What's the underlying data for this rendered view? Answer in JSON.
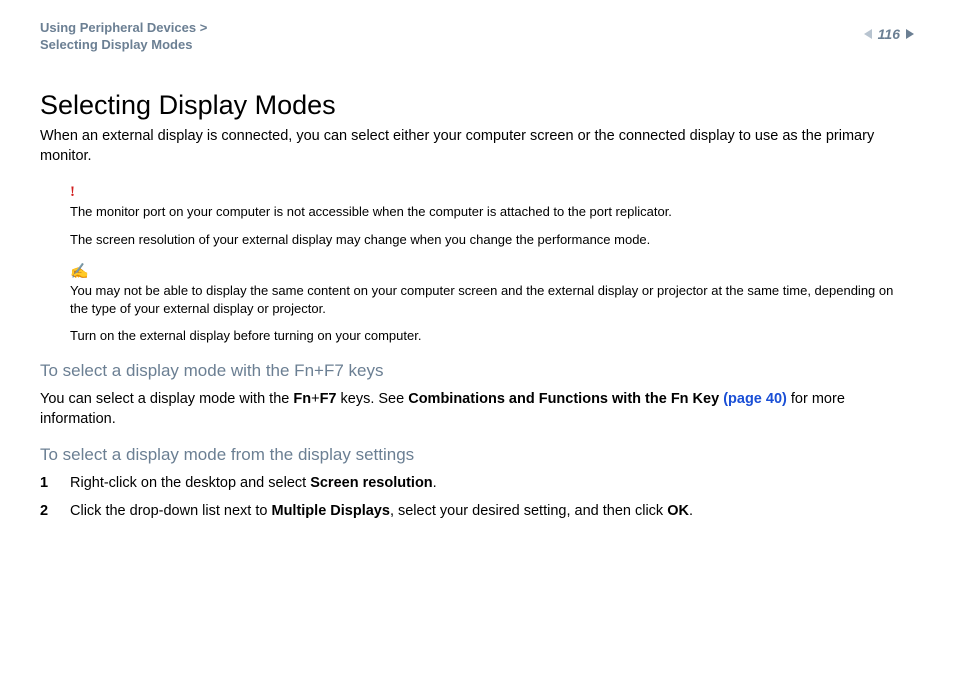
{
  "header": {
    "breadcrumb_line1": "Using Peripheral Devices",
    "breadcrumb_line2": "Selecting Display Modes",
    "page_number": "116"
  },
  "main": {
    "title": "Selecting Display Modes",
    "intro": "When an external display is connected, you can select either your computer screen or the connected display to use as the primary monitor.",
    "warning": {
      "p1": "The monitor port on your computer is not accessible when the computer is attached to the port replicator.",
      "p2": "The screen resolution of your external display may change when you change the performance mode."
    },
    "tip": {
      "p1": "You may not be able to display the same content on your computer screen and the external display or projector at the same time, depending on the type of your external display or projector.",
      "p2": "Turn on the external display before turning on your computer."
    },
    "section1": {
      "heading": "To select a display mode with the Fn+F7 keys",
      "body_pre": "You can select a display mode with the ",
      "fn": "Fn",
      "plus": "+",
      "f7": "F7",
      "body_mid": " keys. See ",
      "link_text_pre": "Combinations and Functions with the Fn Key ",
      "link_page": "(page 40)",
      "body_post": " for more information."
    },
    "section2": {
      "heading": "To select a display mode from the display settings",
      "steps": [
        {
          "pre": "Right-click on the desktop and select ",
          "bold": "Screen resolution",
          "post": "."
        },
        {
          "pre": "Click the drop-down list next to ",
          "bold": "Multiple Displays",
          "mid": ", select your desired setting, and then click ",
          "bold2": "OK",
          "post": "."
        }
      ]
    }
  }
}
